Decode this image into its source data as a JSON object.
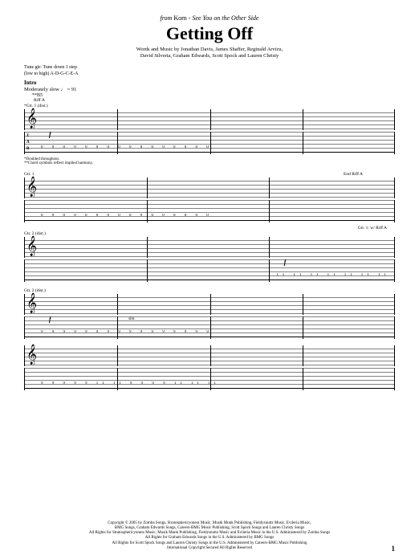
{
  "header": {
    "from_prefix": "from ",
    "artist": "Korn",
    "separator": " - ",
    "album": "See You on the Other Side",
    "title": "Getting Off",
    "credits_line1": "Words and Music by Jonathan Davis, James Shaffer, Reginald Arvizu,",
    "credits_line2": "David Silveria, Graham Edwards, Scott Spock and Lauren Christy"
  },
  "tuning": {
    "line1": "Tune gtr: Tune down 1 step",
    "line2": "(low to high) A-D-G-C-E-A"
  },
  "intro": {
    "label": "Intro",
    "tempo": "Moderately slow ♩ = 91",
    "chord": "**B5"
  },
  "markers": {
    "gtr1": "*Gtr. 1 (dist.)",
    "riff_a": "Riff A",
    "gtr2": "Gtr. 2 (dist.)",
    "gtr1_riff": "Gtr. 1: w/ Riff A",
    "end_riff_a": "End Riff A",
    "sim": "sim."
  },
  "dynamics": {
    "f": "f"
  },
  "footnotes": {
    "n1": "*Doubled throughout.",
    "n2": "**Chord symbols reflect implied harmony."
  },
  "tab_letters": {
    "t": "T",
    "a": "A",
    "b": "B"
  },
  "tab_data": {
    "zeros": "0 0 0 0   0 0 0 0   0 0 0 0   0 0 0 0",
    "elevens": "11 11 11 11   11 11 11 11   11 11 11 11",
    "nines": "9 9 9 9   9 9 9 9   9 9 9 9   9 9 9 9",
    "mixed": "9 9 9 9 9   11 11   9 9 9 9   11 11 11"
  },
  "copyright": {
    "l1": "Copyright © 2005 by Zomba Songs, Stratosphericyoness Music, Musik Munk Publishing, Fieldysnuttz Music, Evileria Music,",
    "l2": "BMG Songs, Graham Edwards Songs, Careers-BMG Music Publishing, Scott Spock Songs and Lauren Christy Songs",
    "l3": "All Rights for Stratosphericyoness Music, Musik Munk Publishing, Fieldysnuttz Music and Evileria Music in the U.S. Administered by Zomba Songs",
    "l4": "All Rights for Graham Edwards Songs in the U.S. Administered by BMG Songs",
    "l5": "All Rights for Scott Spock Songs and Lauren Christy Songs in the U.S. Administered by Careers-BMG Music Publishing",
    "l6": "International Copyright Secured   All Rights Reserved"
  },
  "page_number": "1"
}
